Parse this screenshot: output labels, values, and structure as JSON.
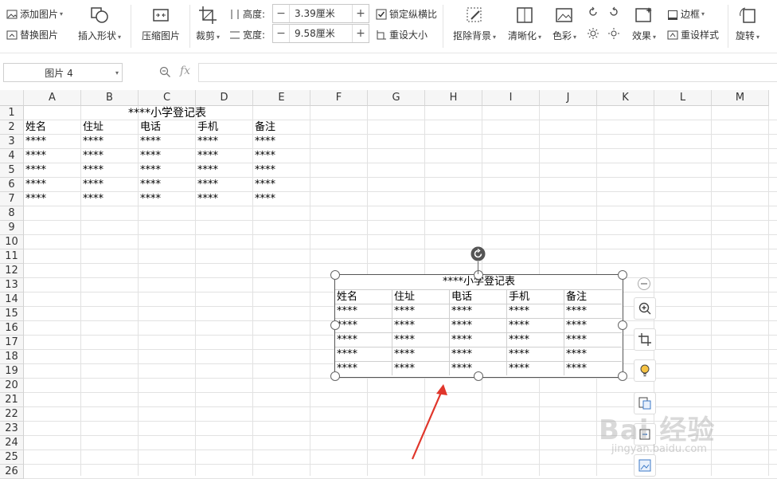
{
  "ribbon": {
    "add_picture": "添加图片",
    "replace_picture": "替换图片",
    "insert_shape": "插入形状",
    "compress_picture": "压缩图片",
    "crop": "裁剪",
    "height_label": "高度:",
    "height_value": "3.39厘米",
    "width_label": "宽度:",
    "width_value": "9.58厘米",
    "lock_ratio": "锁定纵横比",
    "reset_size": "重设大小",
    "remove_bg": "抠除背景",
    "sharpen": "清晰化",
    "color": "色彩",
    "effects": "效果",
    "border": "边框",
    "reset_style": "重设样式",
    "rotate": "旋转"
  },
  "formula_bar": {
    "name_box": "图片 4",
    "fx": "fx",
    "formula": ""
  },
  "sheet": {
    "columns": [
      "A",
      "B",
      "C",
      "D",
      "E",
      "F",
      "G",
      "H",
      "I",
      "J",
      "K",
      "L",
      "M"
    ],
    "rows": [
      "1",
      "2",
      "3",
      "4",
      "5",
      "6",
      "7",
      "8",
      "9",
      "10",
      "11",
      "12",
      "13",
      "14",
      "15",
      "16",
      "17",
      "18",
      "19",
      "20",
      "21",
      "22",
      "23",
      "24",
      "25",
      "26"
    ],
    "title": "****小学登记表",
    "headers": [
      "姓名",
      "住址",
      "电话",
      "手机",
      "备注"
    ],
    "data_rows": [
      [
        "****",
        "****",
        "****",
        "****",
        "****"
      ],
      [
        "****",
        "****",
        "****",
        "****",
        "****"
      ],
      [
        "****",
        "****",
        "****",
        "****",
        "****"
      ],
      [
        "****",
        "****",
        "****",
        "****",
        "****"
      ],
      [
        "****",
        "****",
        "****",
        "****",
        "****"
      ]
    ]
  },
  "picture": {
    "title": "****小学登记表",
    "headers": [
      "姓名",
      "住址",
      "电话",
      "手机",
      "备注"
    ],
    "data_rows": [
      [
        "****",
        "****",
        "****",
        "****",
        "****"
      ],
      [
        "****",
        "****",
        "****",
        "****",
        "****"
      ],
      [
        "****",
        "****",
        "****",
        "****",
        "****"
      ],
      [
        "****",
        "****",
        "****",
        "****",
        "****"
      ],
      [
        "****",
        "****",
        "****",
        "****",
        "****"
      ]
    ]
  },
  "side_toolbar": [
    "zoom-out-icon",
    "zoom-in-icon",
    "crop-icon",
    "idea-icon",
    "convert-icon",
    "extract-icon",
    "picture-tool-icon"
  ],
  "watermark": {
    "main": "Bai 经验",
    "sub": "jingyan.baidu.com"
  },
  "colors": {
    "accent": "#217346",
    "arrow": "#e0362b"
  }
}
